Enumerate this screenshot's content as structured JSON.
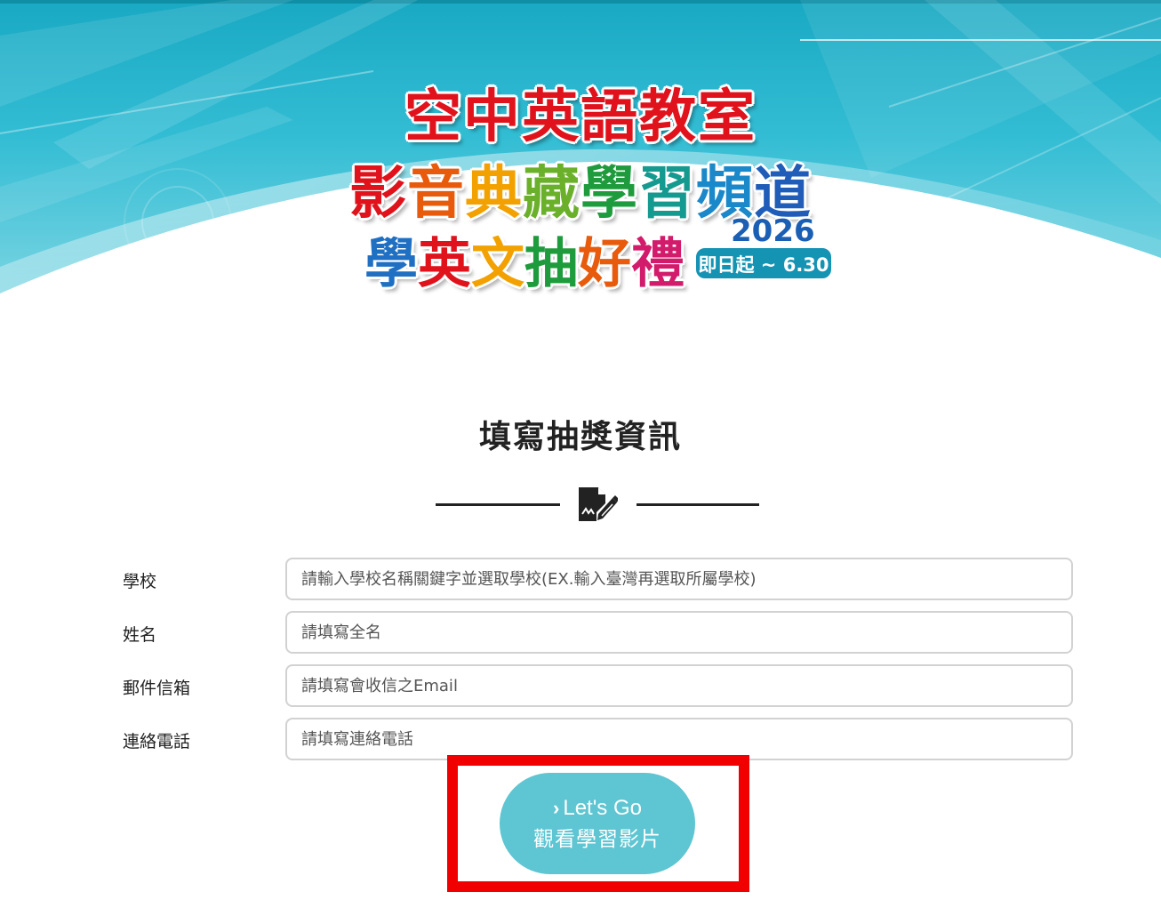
{
  "banner": {
    "title_line1": "空中英語教室",
    "title_line2": [
      "影",
      "音",
      "典",
      "藏",
      "學",
      "習",
      "頻",
      "道"
    ],
    "title_line3": [
      "學",
      "英",
      "文",
      "抽",
      "好",
      "禮"
    ],
    "year": "2026",
    "period": "即日起 ~ 6.30"
  },
  "section": {
    "title": "填寫抽獎資訊",
    "icon": "document-signature-icon"
  },
  "form": {
    "fields": [
      {
        "label": "學校",
        "placeholder": "請輸入學校名稱關鍵字並選取學校(EX.輸入臺灣再選取所屬學校)",
        "value": ""
      },
      {
        "label": "姓名",
        "placeholder": "請填寫全名",
        "value": ""
      },
      {
        "label": "郵件信箱",
        "placeholder": "請填寫會收信之Email",
        "value": ""
      },
      {
        "label": "連絡電話",
        "placeholder": "請填寫連絡電話",
        "value": ""
      }
    ]
  },
  "submit": {
    "chevron": "›",
    "line1": "Let's Go",
    "line2": "觀看學習影片"
  },
  "colors": {
    "banner_teal": "#19a9c3",
    "button": "#5ec5d2",
    "highlight": "#f00000"
  }
}
